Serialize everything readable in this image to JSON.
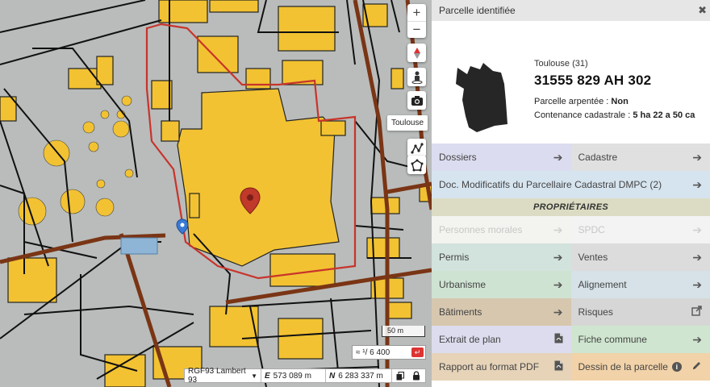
{
  "map": {
    "tooltip": "Toulouse",
    "scale_label": "50 m",
    "scale_ratio": "≈ ¹/ 6 400",
    "crs_select": "RGF93 Lambert 93",
    "east_label": "E",
    "east_value": "573 089 m",
    "north_label": "N",
    "north_value": "6 283 337 m"
  },
  "panel": {
    "title": "Parcelle identifiée",
    "city": "Toulouse (31)",
    "parcel_id": "31555 829 AH 302",
    "arpentee_label": "Parcelle arpentée :",
    "arpentee_value": "Non",
    "contenance_label": "Contenance cadastrale :",
    "contenance_value": "5 ha 22 a 50 ca",
    "buttons": {
      "dossiers": "Dossiers",
      "cadastre": "Cadastre",
      "dmpc": "Doc. Modificatifs du Parcellaire Cadastral DMPC (2)",
      "proprietaires": "PROPRIÉTAIRES",
      "personnes_morales": "Personnes morales",
      "spdc": "SPDC",
      "permis": "Permis",
      "ventes": "Ventes",
      "urbanisme": "Urbanisme",
      "alignement": "Alignement",
      "batiments": "Bâtiments",
      "risques": "Risques",
      "extrait": "Extrait de plan",
      "fiche": "Fiche commune",
      "rapport": "Rapport au format PDF",
      "dessin": "Dessin de la parcelle"
    }
  },
  "colors": {
    "dossiers": "#dcdcf0",
    "cadastre": "#e0e0e0",
    "dmpc": "#d6e4ef",
    "proprietaires": "#dcdcc4",
    "personnes": "#f3f3ef",
    "spdc": "#f3f3f3",
    "permis": "#d2e2dd",
    "ventes": "#dcdcdc",
    "urbanisme": "#cfe3d2",
    "alignement": "#d6e2e8",
    "batiments": "#d6c7ae",
    "risques": "#d6d6d6",
    "extrait": "#dcdcee",
    "fiche": "#cfe5cf",
    "rapport": "#e6d3b8",
    "dessin": "#f2d2a8"
  }
}
